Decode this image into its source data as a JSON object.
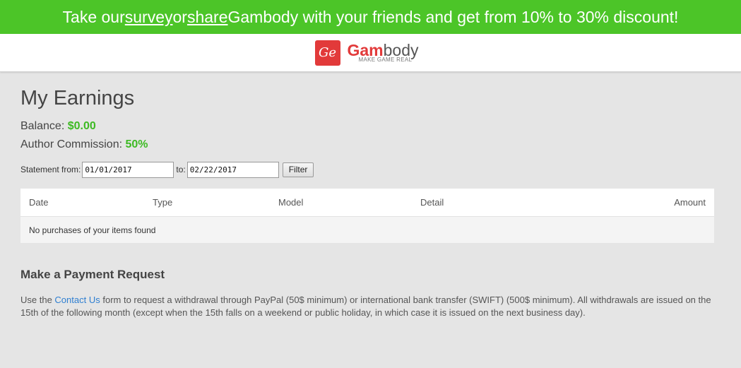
{
  "promo": {
    "text_before": "Take our ",
    "survey_link": "survey",
    "text_or": " or ",
    "share_link": "share",
    "text_after": " Gambody with your friends and get from 10% to 30% discount!"
  },
  "header": {
    "logo_mark": "Ge",
    "logo_word_a": "Gam",
    "logo_word_b": "body",
    "tagline": "MAKE GAME REAL"
  },
  "page": {
    "title": "My Earnings",
    "balance_label": "Balance:",
    "balance_value": "$0.00",
    "commission_label": "Author Commission:",
    "commission_value": "50%"
  },
  "filter": {
    "from_label": "Statement from:",
    "from_value": "01/01/2017",
    "to_label": "to:",
    "to_value": "02/22/2017",
    "button_label": "Filter"
  },
  "table": {
    "columns": [
      "Date",
      "Type",
      "Model",
      "Detail",
      "Amount"
    ],
    "empty_message": "No purchases of your items found"
  },
  "payment": {
    "title": "Make a Payment Request",
    "text_before": "Use the ",
    "link": "Contact Us",
    "text_after": " form to request a withdrawal through PayPal (50$ minimum) or international bank transfer (SWIFT) (500$ minimum). All withdrawals are issued on the 15th of the following month (except when the 15th falls on a weekend or public holiday, in which case it is issued on the next business day)."
  },
  "colors": {
    "promo_green": "#4cc528",
    "value_green": "#3dba23",
    "brand_red": "#e23a3a",
    "link_blue": "#2f7fd1"
  }
}
